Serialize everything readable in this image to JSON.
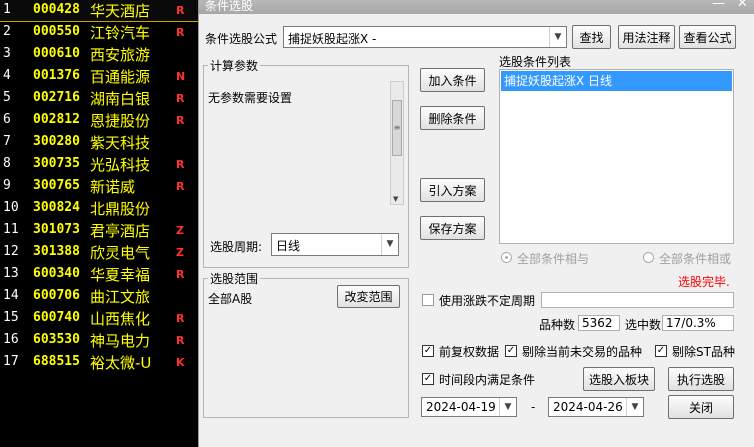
{
  "stock_list": [
    {
      "num": "1",
      "code": "000428",
      "name": "华天酒店",
      "flag": "R"
    },
    {
      "num": "2",
      "code": "000550",
      "name": "江铃汽车",
      "flag": "R"
    },
    {
      "num": "3",
      "code": "000610",
      "name": "西安旅游",
      "flag": ""
    },
    {
      "num": "4",
      "code": "001376",
      "name": "百通能源",
      "flag": "N"
    },
    {
      "num": "5",
      "code": "002716",
      "name": "湖南白银",
      "flag": "R"
    },
    {
      "num": "6",
      "code": "002812",
      "name": "恩捷股份",
      "flag": "R"
    },
    {
      "num": "7",
      "code": "300280",
      "name": "紫天科技",
      "flag": ""
    },
    {
      "num": "8",
      "code": "300735",
      "name": "光弘科技",
      "flag": "R"
    },
    {
      "num": "9",
      "code": "300765",
      "name": "新诺威",
      "flag": "R"
    },
    {
      "num": "10",
      "code": "300824",
      "name": "北鼎股份",
      "flag": ""
    },
    {
      "num": "11",
      "code": "301073",
      "name": "君亭酒店",
      "flag": "Z"
    },
    {
      "num": "12",
      "code": "301388",
      "name": "欣灵电气",
      "flag": "Z"
    },
    {
      "num": "13",
      "code": "600340",
      "name": "华夏幸福",
      "flag": "R"
    },
    {
      "num": "14",
      "code": "600706",
      "name": "曲江文旅",
      "flag": ""
    },
    {
      "num": "15",
      "code": "600740",
      "name": "山西焦化",
      "flag": "R"
    },
    {
      "num": "16",
      "code": "603530",
      "name": "神马电力",
      "flag": "R"
    },
    {
      "num": "17",
      "code": "688515",
      "name": "裕太微-U",
      "flag": "K"
    }
  ],
  "dialog": {
    "title": "条件选股",
    "minimize": "—",
    "close": "✕",
    "formula_label": "条件选股公式",
    "formula_value": "捕捉妖股起涨X  -",
    "find_button": "查找",
    "usage_button": "用法注释",
    "view_formula_button": "查看公式",
    "calc_params_title": "计算参数",
    "no_params_text": "无参数需要设置",
    "period_label": "选股周期:",
    "period_value": "日线",
    "add_condition": "加入条件",
    "delete_condition": "删除条件",
    "import_plan": "引入方案",
    "save_plan": "保存方案",
    "condition_list_title": "选股条件列表",
    "condition_item": "捕捉妖股起涨X  日线",
    "radio_and": "全部条件相与",
    "radio_or": "全部条件相或",
    "status": "选股完毕.",
    "range_title": "选股范围",
    "range_value": "全部A股",
    "change_range": "改変范围",
    "use_uncertain": "使用涨跌不定周期",
    "count_label": "品种数",
    "count_value": "5362",
    "selected_label": "选中数",
    "selected_value": "17/0.3%",
    "pre_rights": "前复权数据",
    "exclude_untraded": "剔除当前未交易的品种",
    "exclude_st": "剔除ST品种",
    "time_period": "时间段内满足条件",
    "to_block": "选股入板块",
    "execute": "执行选股",
    "date_from": "2024-04-19",
    "date_sep": "-",
    "date_to": "2024-04-26",
    "close_button": "关闭",
    "check_mark": "✓"
  },
  "colors": {
    "code": "#ffff00",
    "flag": "#ff3030",
    "status": "#ff0000",
    "selection": "#3399ff"
  }
}
